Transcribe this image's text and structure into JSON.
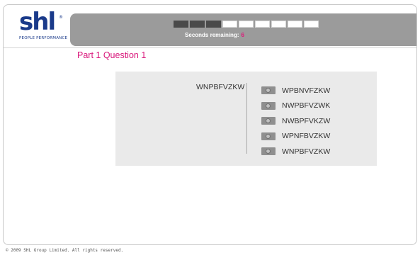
{
  "logo": {
    "text": "shl",
    "registered": "®",
    "tagline": "PEOPLE PERFORMANCE"
  },
  "header": {
    "progress": {
      "total_segments": 9,
      "filled_segments": 3,
      "fraction_filled": 0.33
    },
    "timer_label": "Seconds remaining:",
    "timer_value": "6"
  },
  "question": {
    "title": "Part 1 Question 1",
    "target": "WNPBFVZKW",
    "options": [
      {
        "label": "WPBNVFZKW"
      },
      {
        "label": "NWPBFVZWK"
      },
      {
        "label": "NWBPFVKZW"
      },
      {
        "label": "WPNFBVZKW"
      },
      {
        "label": "WNPBFVZKW"
      }
    ]
  },
  "footer": {
    "copyright": "© 2009 SHL Group Limited. All rights reserved."
  },
  "colors": {
    "accent": "#d9177b",
    "brand": "#1a3a8a",
    "header_bar": "#9b9b9b",
    "panel": "#eaeaea"
  }
}
